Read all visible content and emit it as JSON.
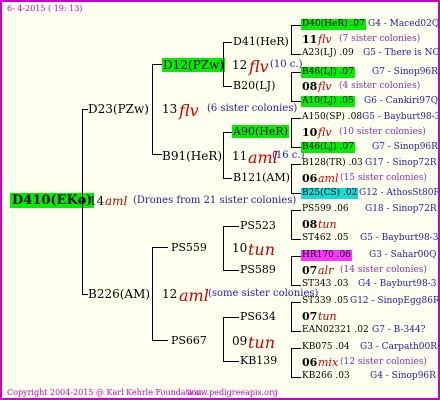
{
  "header": {
    "date": "6- 4-2015 ( 19: 13)"
  },
  "footer": {
    "copyright": "Copyright 2004-2015 @ Karl Kehrle Foundation.",
    "url": "www.pedigreeapis.org"
  },
  "root": {
    "name": "D410(EKo)",
    "count": "14",
    "type": "aml",
    "note": "(Drones from 21 sister colonies)"
  },
  "gen1": [
    {
      "name": "D23(PZw)",
      "count": "13",
      "type": "flv",
      "note": "(6 sister colonies)"
    },
    {
      "name": "B226(AM)",
      "count": "12",
      "type": "aml",
      "note": "(some sister colonies)"
    }
  ],
  "gen2": [
    {
      "name": "D12(PZw)",
      "count": "12",
      "type": "flv",
      "note": "(10 c.)"
    },
    {
      "name": "B91(HeR)",
      "count": "11",
      "type": "aml",
      "note": "(16 c.)"
    },
    {
      "name": "PS559",
      "count": "10",
      "type": "tun",
      "note": ""
    },
    {
      "name": "PS667",
      "count": "09",
      "type": "tun",
      "note": ""
    }
  ],
  "gen3": [
    {
      "name": "D41(HeR)"
    },
    {
      "name": "B20(LJ)"
    },
    {
      "name": "A90(HeR)"
    },
    {
      "name": "B121(AM)"
    },
    {
      "name": "PS523"
    },
    {
      "name": "PS589"
    },
    {
      "name": "PS634"
    },
    {
      "name": "KB139"
    }
  ],
  "gen4": [
    {
      "top": "D40(HeR) .07",
      "top_id": "G4 - Maced02Q",
      "count": "11",
      "type": "flv",
      "note": "(7 sister colonies)",
      "bottom": "A23(LJ) .09",
      "bottom_id": "G5 - There is NO"
    },
    {
      "top": "B46(LJ) .07",
      "top_id": "G7 - Sinop96R",
      "count": "08",
      "type": "flv",
      "note": "(4 sister colonies)",
      "bottom": "A10(LJ) .05",
      "bottom_id": "G6 - Cankiri97Q"
    },
    {
      "top": "A150(SP) .08",
      "top_id": "G5 - Bayburt98-3",
      "count": "10",
      "type": "flv",
      "note": "(10 sister colonies)",
      "bottom": "B46(LJ) .07",
      "bottom_id": "G7 - Sinop96R"
    },
    {
      "top": "B128(TR) .03",
      "top_id": "G17 - Sinop72R",
      "count": "06",
      "type": "aml",
      "note": "(15 sister colonies)",
      "bottom": "B25(CS) .02",
      "bottom_id": "G12 - AthosSt80R"
    },
    {
      "top": "PS599 .06",
      "top_id": "G18 - Sinop72R",
      "count": "08",
      "type": "tun",
      "note": "",
      "bottom": "ST462 .05",
      "bottom_id": "G5 - Bayburt98-3"
    },
    {
      "top": "HR170 .06",
      "top_id": "G3 - Sahar00Q",
      "count": "07",
      "type": "alr",
      "note": "(14 sister colonies)",
      "bottom": "ST343 .03",
      "bottom_id": "G4 - Bayburt98-3"
    },
    {
      "top": "ST339 .05",
      "top_id": "G12 - SinopEgg86R",
      "count": "07",
      "type": "tun",
      "note": "",
      "bottom": "EAN02321 .02",
      "bottom_id": "G7 - B-344?"
    },
    {
      "top": "KB075 .04",
      "top_id": "G3 - Carpath00R",
      "count": "06",
      "type": "mix",
      "note": "(12 sister colonies)",
      "bottom": "KB266 .03",
      "bottom_id": "G4 - Sinop96R"
    }
  ]
}
